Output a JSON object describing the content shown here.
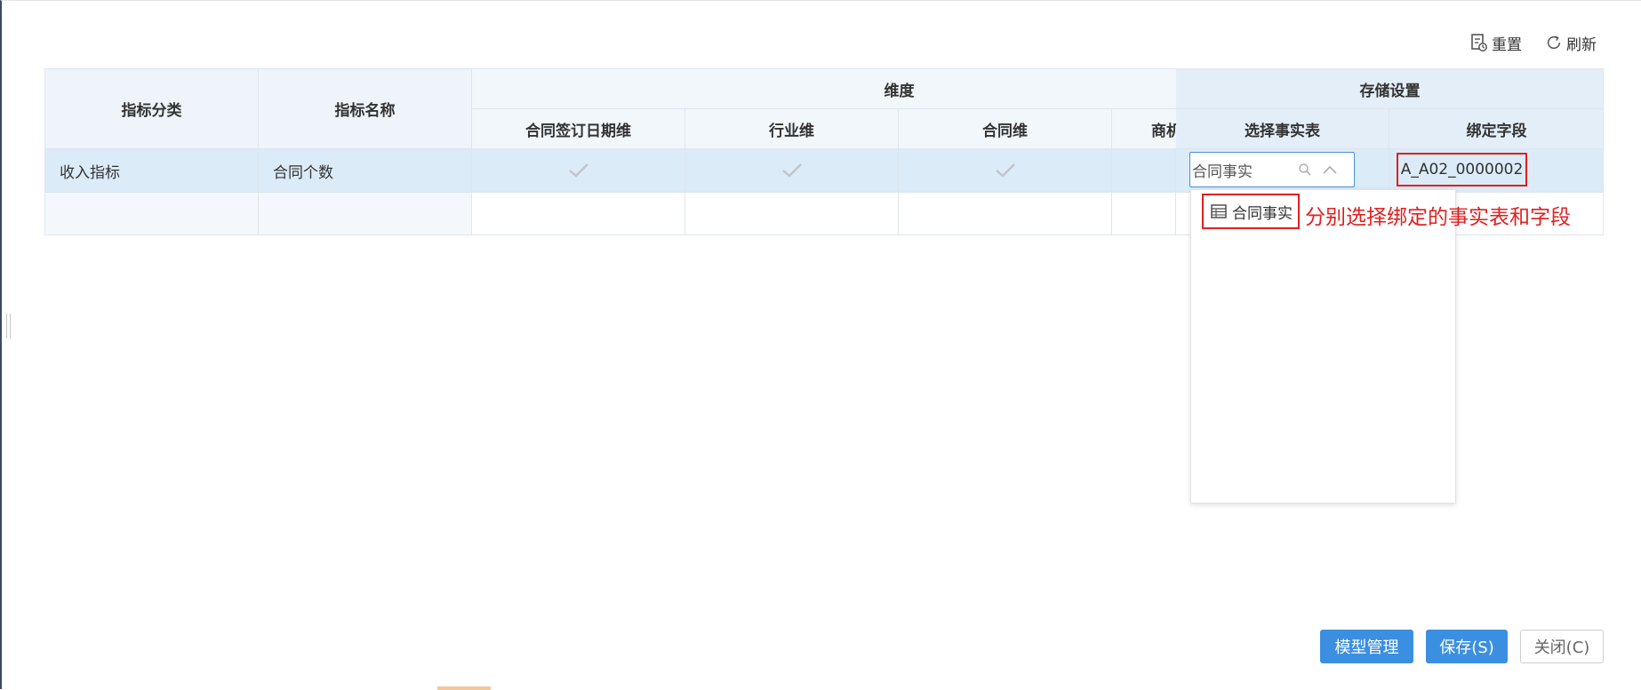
{
  "toolbar": {
    "reset_label": "重置",
    "refresh_label": "刷新"
  },
  "table": {
    "header": {
      "category": "指标分类",
      "name": "指标名称",
      "dimension_group": "维度",
      "storage_group": "存储设置",
      "dim_columns": [
        "合同签订日期维",
        "行业维",
        "合同维",
        "商机"
      ],
      "storage_columns": [
        "选择事实表",
        "绑定字段"
      ]
    },
    "rows": [
      {
        "category": "收入指标",
        "name": "合同个数",
        "dims_checked": [
          true,
          true,
          true,
          false
        ],
        "fact_table": "合同事实",
        "bind_field": "A_A02_0000002"
      }
    ]
  },
  "dropdown": {
    "options": [
      "合同事实"
    ]
  },
  "annotation": "分别选择绑定的事实表和字段",
  "footer": {
    "model_manage_label": "模型管理",
    "save_label": "保存(S)",
    "close_label": "关闭(C)"
  },
  "colors": {
    "primary": "#3b8fe0",
    "highlight_red": "#e02020",
    "selected_row": "#dcebf8",
    "header_bg": "#eef4fa"
  },
  "icons": {
    "reset": "reset-icon",
    "refresh": "refresh-icon",
    "check": "check-icon",
    "search": "search-icon",
    "chevron_up": "chevron-up-icon",
    "table": "table-icon"
  }
}
